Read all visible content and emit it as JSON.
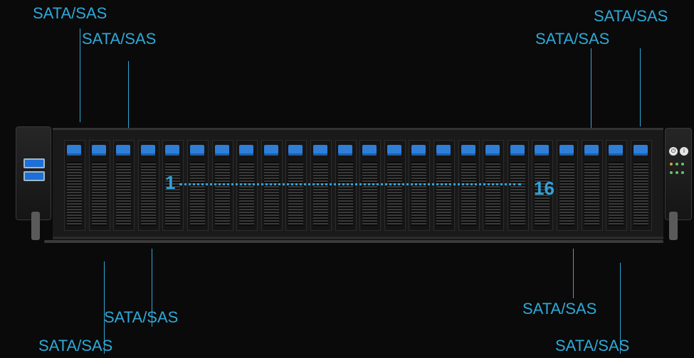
{
  "labels": {
    "top_left_1": "SATA/SAS",
    "top_left_2": "SATA/SAS",
    "top_right_1": "SATA/SAS",
    "top_right_2": "SATA/SAS",
    "bottom_left_1": "SATA/SAS",
    "bottom_left_2": "SATA/SAS",
    "bottom_right_1": "SATA/SAS",
    "bottom_right_2": "SATA/SAS"
  },
  "bay_range": {
    "start": "1",
    "end": "16"
  },
  "drive_count": 24,
  "colors": {
    "accent": "#2ea8d8",
    "latch": "#2f7fd8",
    "background": "#0a0a0a"
  },
  "icons": [
    "usb-port-icon",
    "power-button-icon",
    "id-button-icon",
    "status-led-icon"
  ]
}
